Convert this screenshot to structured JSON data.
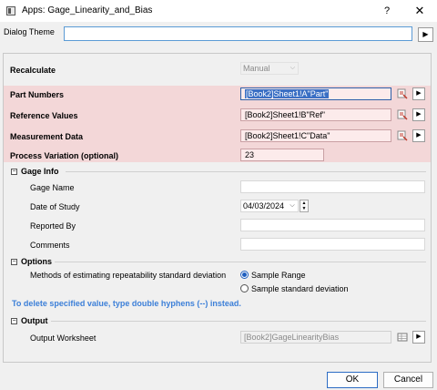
{
  "window": {
    "title": "Apps: Gage_Linearity_and_Bias",
    "help": "?",
    "close": "✕"
  },
  "dialog_theme": {
    "label": "Dialog Theme",
    "value": ""
  },
  "recalculate": {
    "label": "Recalculate",
    "value": "Manual"
  },
  "part_numbers": {
    "label": "Part Numbers",
    "value": "[Book2]Sheet1!A\"Part\""
  },
  "reference_values": {
    "label": "Reference Values",
    "value": "[Book2]Sheet1!B\"Ref\""
  },
  "measurement_data": {
    "label": "Measurement Data",
    "value": "[Book2]Sheet1!C\"Data\""
  },
  "process_variation": {
    "label": "Process Variation (optional)",
    "value": "23"
  },
  "gage_info": {
    "title": "Gage Info",
    "gage_name": {
      "label": "Gage Name",
      "value": ""
    },
    "date_of_study": {
      "label": "Date of Study",
      "value": "04/03/2024"
    },
    "reported_by": {
      "label": "Reported By",
      "value": ""
    },
    "comments": {
      "label": "Comments",
      "value": ""
    }
  },
  "options": {
    "title": "Options",
    "method_label": "Methods of estimating repeatability standard deviation",
    "radio_range": "Sample Range",
    "radio_std": "Sample standard deviation",
    "selected": "Sample Range"
  },
  "note": "To delete specified value, type double hyphens (--) instead.",
  "output": {
    "title": "Output",
    "worksheet_label": "Output Worksheet",
    "worksheet_value": "[Book2]GageLinearityBias"
  },
  "buttons": {
    "ok": "OK",
    "cancel": "Cancel"
  },
  "colors": {
    "highlight": "#f3d7d8",
    "accent": "#1f5fbf",
    "note": "#3c7fd8"
  }
}
